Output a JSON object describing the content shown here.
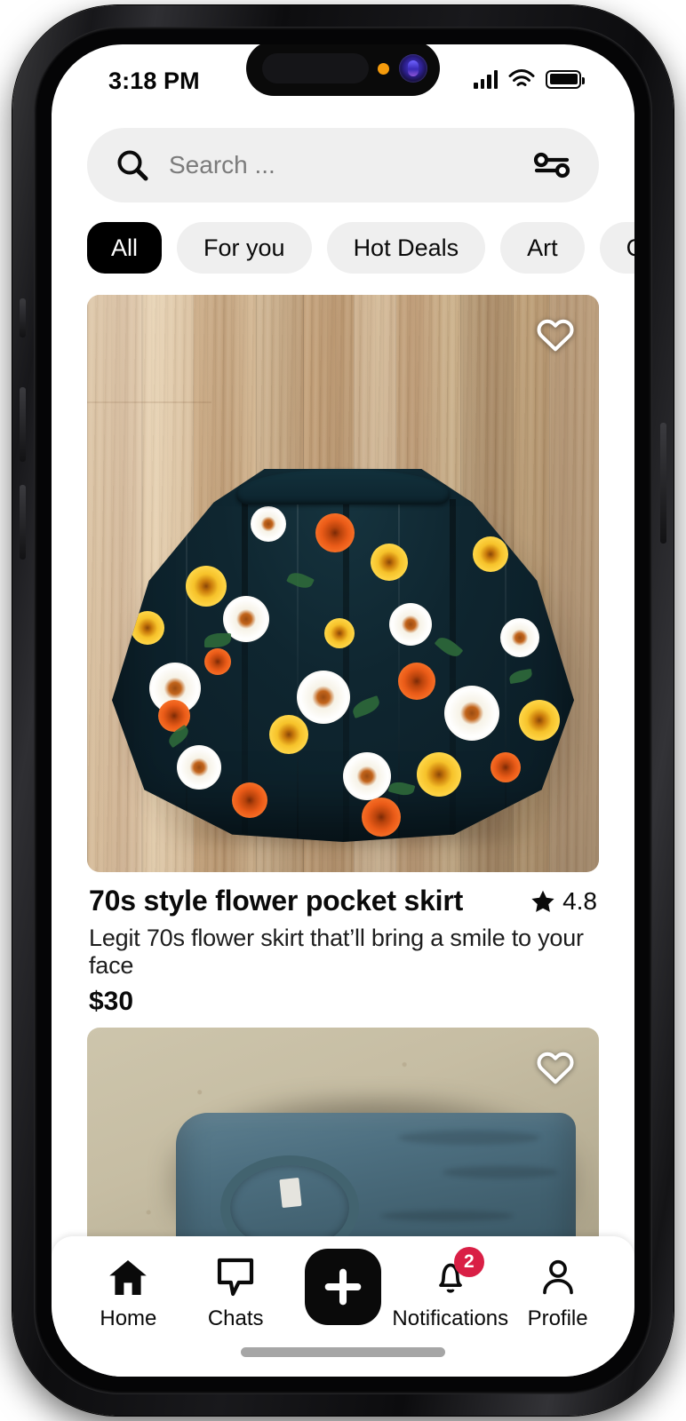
{
  "status_bar": {
    "time": "3:18 PM",
    "signal_icon": "cellular-bars-icon",
    "wifi_icon": "wifi-icon",
    "battery_icon": "battery-full-icon"
  },
  "search": {
    "placeholder": "Search ...",
    "search_icon": "search-icon",
    "filter_icon": "filter-sliders-icon"
  },
  "categories": {
    "active": "All",
    "chips": [
      {
        "label": "All",
        "active": true
      },
      {
        "label": "For you",
        "active": false
      },
      {
        "label": "Hot Deals",
        "active": false
      },
      {
        "label": "Art",
        "active": false
      },
      {
        "label": "Chirop",
        "active": false
      }
    ]
  },
  "listings": [
    {
      "title": "70s style flower pocket skirt",
      "description": "Legit 70s flower skirt that’ll bring a smile to your face",
      "price": "$30",
      "rating": "4.8",
      "rating_icon": "star-icon",
      "favorite_icon": "heart-outline-icon",
      "image_alt": "floral skirt on wood floor"
    },
    {
      "title": "",
      "description": "",
      "price": "",
      "rating": "",
      "rating_icon": "star-icon",
      "favorite_icon": "heart-outline-icon",
      "image_alt": "blue t-shirt on concrete floor"
    }
  ],
  "bottom_nav": {
    "items": [
      {
        "label": "Home",
        "icon": "home-icon",
        "active": true
      },
      {
        "label": "Chats",
        "icon": "chat-bubble-icon",
        "active": false
      },
      {
        "label": "",
        "icon": "plus-icon",
        "active": false
      },
      {
        "label": "Notifications",
        "icon": "bell-icon",
        "badge": "2",
        "active": false
      },
      {
        "label": "Profile",
        "icon": "person-icon",
        "active": false
      }
    ]
  },
  "colors": {
    "accent_black": "#000000",
    "chip_bg": "#efefef",
    "badge_red": "#d91f45",
    "placeholder_gray": "#7b7b7b",
    "home_indicator": "#a6a6a6"
  }
}
